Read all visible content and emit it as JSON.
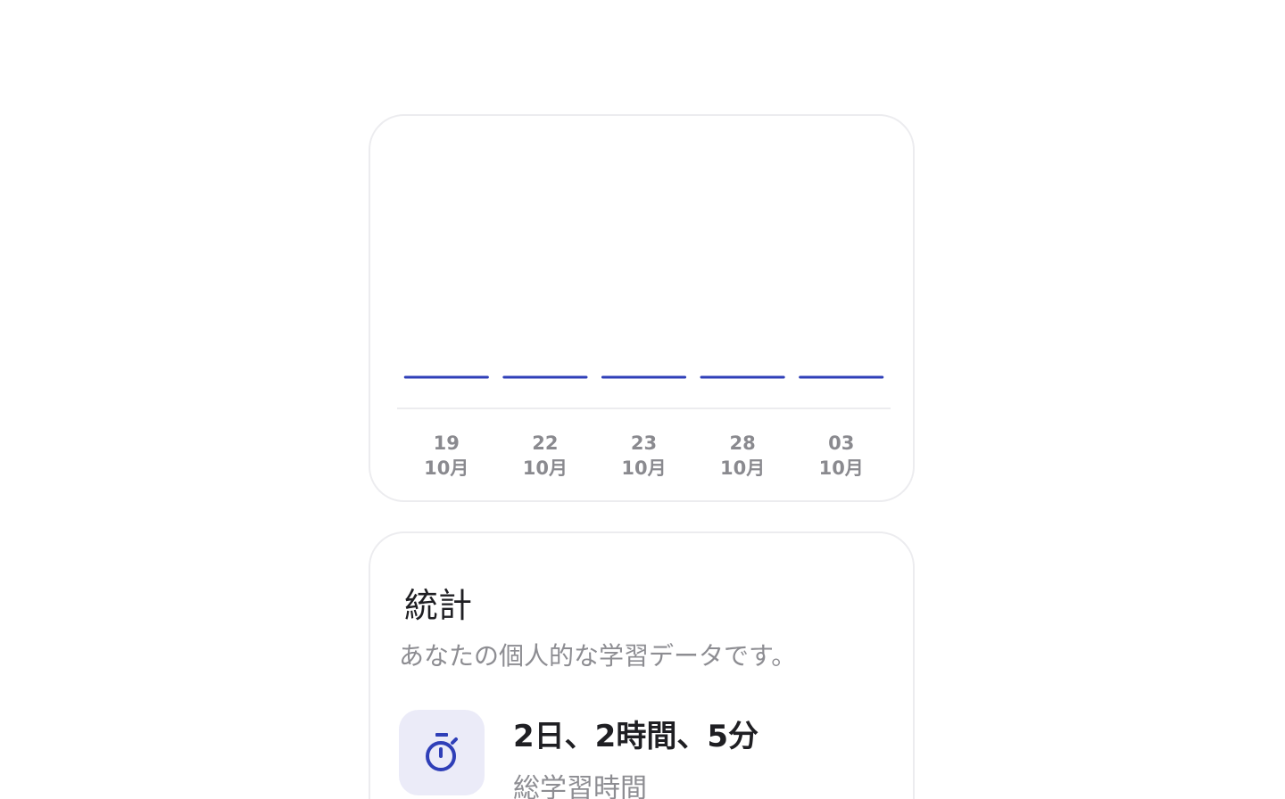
{
  "chart_data": {
    "type": "bar",
    "categories": [
      "19 10月",
      "22 10月",
      "23 10月",
      "28 10月",
      "03 10月"
    ],
    "x_labels": [
      {
        "day": "19",
        "month": "10月"
      },
      {
        "day": "22",
        "month": "10月"
      },
      {
        "day": "23",
        "month": "10月"
      },
      {
        "day": "28",
        "month": "10月"
      },
      {
        "day": "03",
        "month": "10月"
      }
    ],
    "values": [
      0,
      0,
      0,
      0,
      0
    ],
    "ylim": [
      0,
      1
    ],
    "bar_color": "#2f3fb8",
    "baseline_color": "#ececef",
    "grid": false
  },
  "stats": {
    "title": "統計",
    "subtitle": "あなたの個人的な学習データです。",
    "items": [
      {
        "icon": "stopwatch-icon",
        "value": "2日、2時間、5分",
        "label": "総学習時間"
      }
    ]
  },
  "colors": {
    "accent": "#2f3fb8",
    "icon_bg": "#ebebf8",
    "muted_text": "#8d8d92",
    "card_border": "#ececef"
  }
}
